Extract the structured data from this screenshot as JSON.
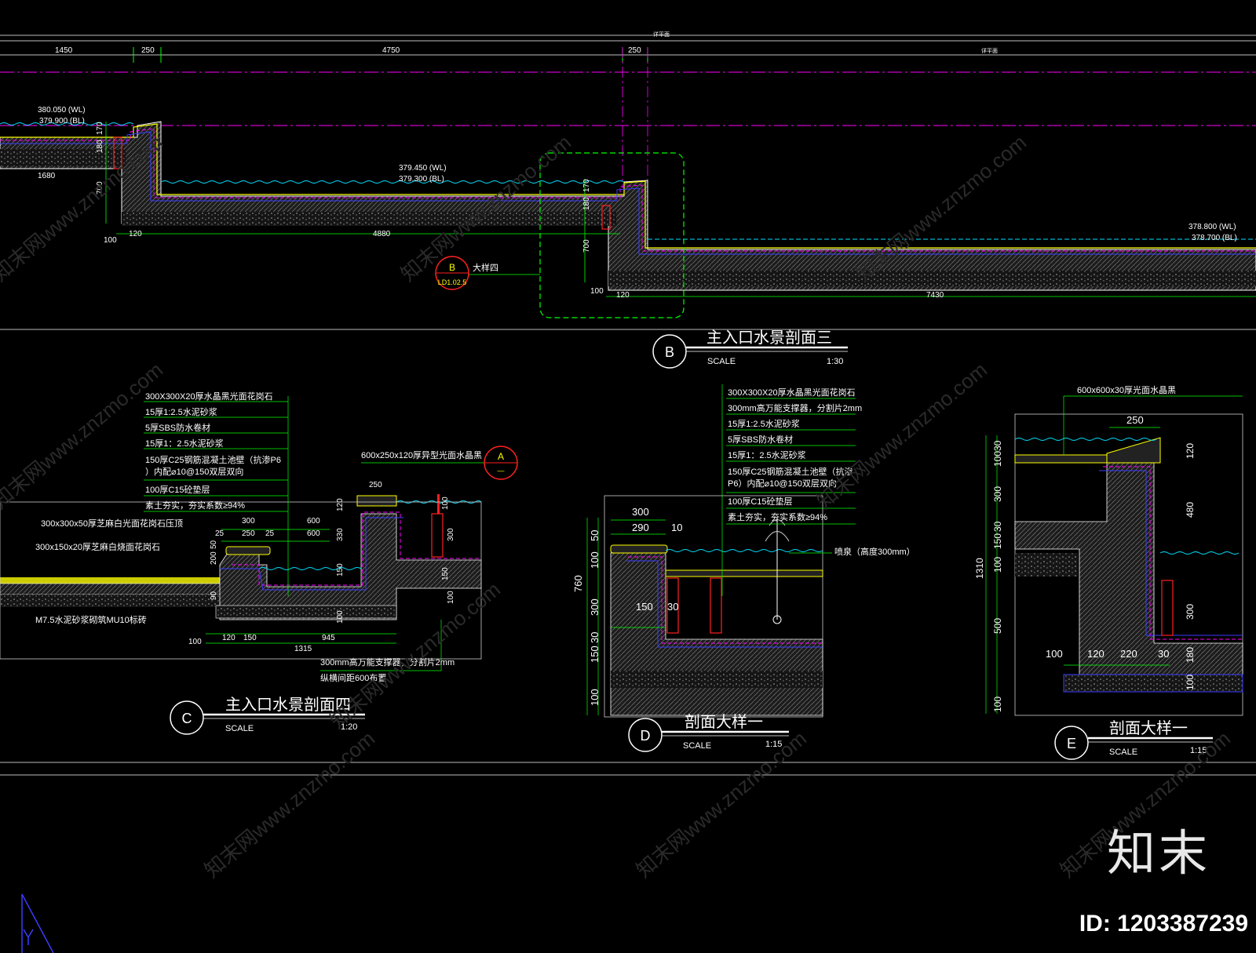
{
  "colors": {
    "background": "#000000",
    "line": "#ffffff",
    "concrete": "#3a3a3a",
    "water": "#00e0ff",
    "wall": "#3b3bff",
    "dash": "#ff00ff",
    "paving": "#ffff00",
    "highlight": "#00ff00",
    "label": "#ff2020",
    "lime": "#40ff40"
  },
  "top_dims": [
    "1450",
    "250",
    "4750",
    "250"
  ],
  "top_axis_labels": [
    "详平面",
    "详平面"
  ],
  "section_b": {
    "levels": [
      {
        "wl": "380.050 (WL)",
        "bl": "379.900 (BL)"
      },
      {
        "wl": "379.450 (WL)",
        "bl": "379.300 (BL)"
      },
      {
        "wl": "378.800 (WL)",
        "bl": "378.700 (BL)"
      }
    ],
    "dims": [
      "170",
      "180",
      "700",
      "1680",
      "100",
      "120",
      "4880",
      "170",
      "180",
      "700",
      "100",
      "120",
      "7430"
    ],
    "callout": {
      "letter": "B",
      "sheet": "LD1.02.5",
      "text": "大样四"
    },
    "title": {
      "letter": "B",
      "name": "主入口水景剖面三",
      "scale_word": "SCALE",
      "scale": "1:30"
    }
  },
  "section_c": {
    "notes": [
      "300X300X20厚水晶黑光面花岗石",
      "15厚1:2.5水泥砂浆",
      "5厚SBS防水卷材",
      "15厚1：2.5水泥砂浆",
      "150厚C25钢筋混凝土池壁（抗渗P6",
      "）内配⌀10@150双层双向",
      "100厚C15砼垫层",
      "素土夯实，夯实系数≥94%"
    ],
    "side_notes": [
      "300x300x50厚芝麻白光面花岗石压顶",
      "300x150x20厚芝麻白烧面花岗石",
      "M7.5水泥砂浆砌筑MU10标砖"
    ],
    "top_note": "600x250x120厚异型光面水晶黑",
    "callout": {
      "letter": "A",
      "sheet": "—"
    },
    "bottom_notes": [
      "300mm高万能支撑器，分割片2mm",
      "纵横间距600布置"
    ],
    "dims": [
      "300",
      "600",
      "25",
      "250",
      "25",
      "600",
      "250",
      "120",
      "330",
      "150",
      "100",
      "200",
      "50",
      "90",
      "100",
      "120",
      "150",
      "1315",
      "945",
      "100",
      "150",
      "300",
      "100"
    ],
    "title": {
      "letter": "C",
      "name": "主入口水景剖面四",
      "scale_word": "SCALE",
      "scale": "1:20"
    }
  },
  "section_d": {
    "notes": [
      "300X300X20厚水晶黑光面花岗石",
      "300mm高万能支撑器，分割片2mm",
      "15厚1:2.5水泥砂浆",
      "5厚SBS防水卷材",
      "15厚1：2.5水泥砂浆",
      "150厚C25钢筋混凝土池壁（抗渗",
      "P6）内配⌀10@150双层双向",
      "100厚C15砼垫层",
      "素土夯实，夯实系数≥94%"
    ],
    "fountain_note": "喷泉（高度300mm）",
    "dims": [
      "300",
      "290",
      "10",
      "50",
      "100",
      "760",
      "300",
      "150",
      "30",
      "30",
      "150",
      "100"
    ],
    "title": {
      "letter": "D",
      "name": "剖面大样一",
      "scale_word": "SCALE",
      "scale": "1:15"
    }
  },
  "section_e": {
    "top_note": "600x600x30厚光面水晶黑",
    "dims": [
      "250",
      "30",
      "100",
      "120",
      "300",
      "480",
      "30",
      "150",
      "100",
      "1310",
      "500",
      "100",
      "120",
      "220",
      "30",
      "300",
      "180",
      "100",
      "100"
    ],
    "title": {
      "letter": "E",
      "name": "剖面大样一",
      "scale_word": "SCALE",
      "scale": "1:15"
    }
  },
  "watermarks": [
    "知末网www.znzmo.com"
  ],
  "brand": {
    "name": "知末",
    "id": "ID: 1203387239"
  }
}
